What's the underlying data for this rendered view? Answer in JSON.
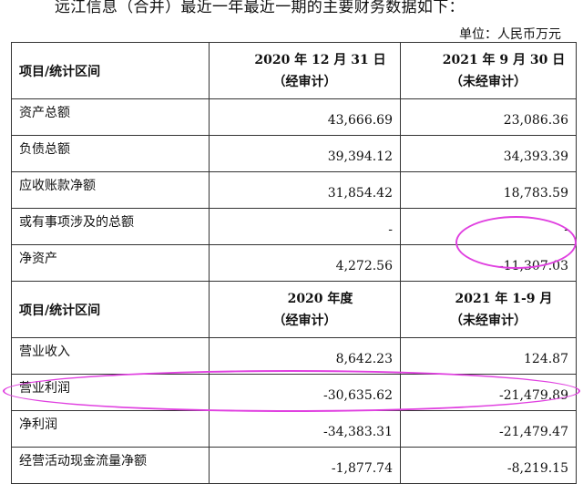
{
  "intro": "远江信息（合并）最近一年最近一期的主要财务数据如下：",
  "unit": "单位：人民币万元",
  "balance": {
    "header_label": "项目/统计区间",
    "col1": [
      "2020 年 12 月 31 日",
      "（经审计）"
    ],
    "col2": [
      "2021 年 9 月 30 日",
      "（未经审计）"
    ],
    "rows": [
      {
        "label": "资产总额",
        "v1": "43,666.69",
        "v2": "23,086.36"
      },
      {
        "label": "负债总额",
        "v1": "39,394.12",
        "v2": "34,393.39"
      },
      {
        "label": "应收账款净额",
        "v1": "31,854.42",
        "v2": "18,783.59"
      },
      {
        "label": "或有事项涉及的总额",
        "v1": "-",
        "v2": "-"
      },
      {
        "label": "净资产",
        "v1": "4,272.56",
        "v2": "-11,307.03"
      }
    ]
  },
  "income": {
    "header_label": "项目/统计区间",
    "col1": [
      "2020 年度",
      "（经审计）"
    ],
    "col2": [
      "2021 年 1-9 月",
      "（未经审计）"
    ],
    "rows": [
      {
        "label": "营业收入",
        "v1": "8,642.23",
        "v2": "124.87"
      },
      {
        "label": "营业利润",
        "v1": "-30,635.62",
        "v2": "-21,479.89"
      },
      {
        "label": "净利润",
        "v1": "-34,383.31",
        "v2": "-21,479.47"
      },
      {
        "label": "经营活动现金流量净额",
        "v1": "-1,877.74",
        "v2": "-8,219.15"
      }
    ]
  },
  "highlight_color": "#e040e0"
}
